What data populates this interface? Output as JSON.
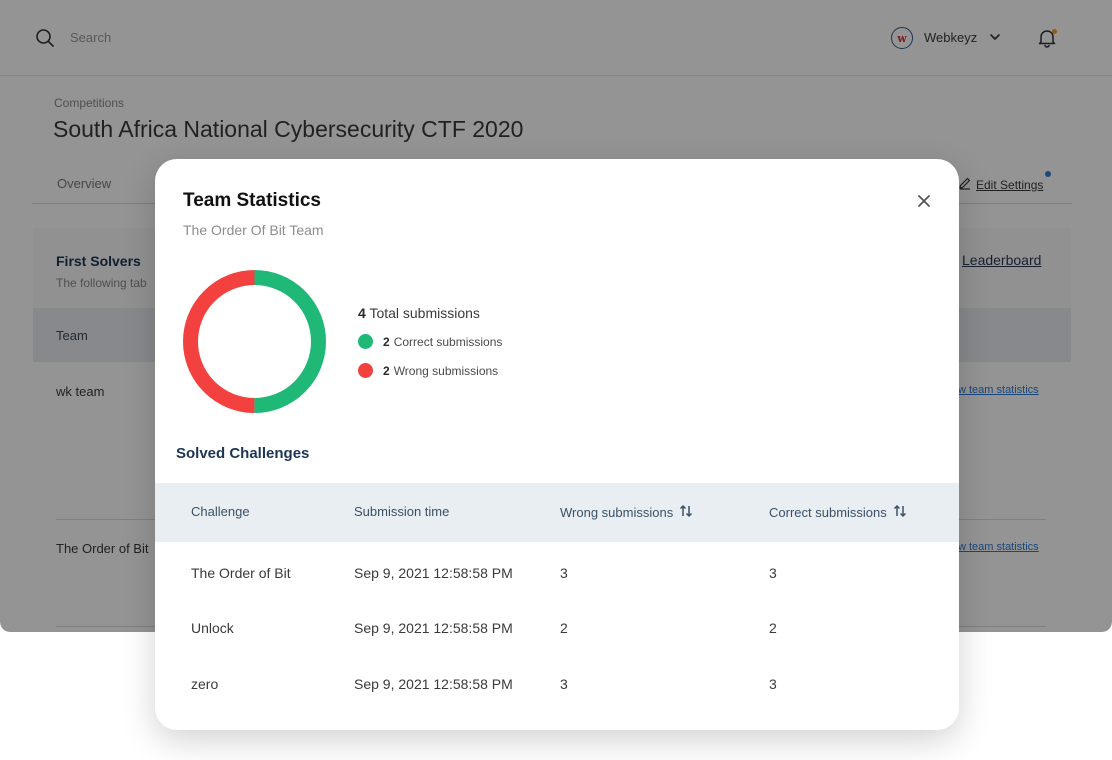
{
  "header": {
    "search_placeholder": "Search",
    "org_name": "Webkeyz",
    "org_logo_text": "w"
  },
  "page": {
    "breadcrumb": "Competitions",
    "title": "South Africa National Cybersecurity CTF 2020",
    "tab_overview": "Overview",
    "edit_settings": "Edit Settings"
  },
  "first_solvers": {
    "title": "First Solvers",
    "subtitle": "The following tab",
    "leaderboard_link": "Leaderboard",
    "column_team": "Team",
    "rows": [
      {
        "team": "wk team",
        "link": "w team statistics"
      },
      {
        "team": "The Order of Bit",
        "link": "w team statistics"
      }
    ]
  },
  "modal": {
    "title": "Team Statistics",
    "subtitle": "The Order Of Bit Team",
    "total_count": "4",
    "total_label": "Total submissions",
    "correct_count": "2",
    "correct_label": "Correct submissions",
    "wrong_count": "2",
    "wrong_label": "Wrong submissions",
    "solved_title": "Solved Challenges",
    "columns": [
      "Challenge",
      "Submission time",
      "Wrong submissions",
      "Correct submissions"
    ],
    "rows": [
      {
        "challenge": "The Order of Bit",
        "time": "Sep 9, 2021 12:58:58 PM",
        "wrong": "3",
        "correct": "3"
      },
      {
        "challenge": "Unlock",
        "time": "Sep 9, 2021 12:58:58 PM",
        "wrong": "2",
        "correct": "2"
      },
      {
        "challenge": "zero",
        "time": "Sep 9, 2021 12:58:58 PM",
        "wrong": "3",
        "correct": "3"
      }
    ]
  },
  "chart_data": {
    "type": "pie",
    "categories": [
      "Correct submissions",
      "Wrong submissions"
    ],
    "values": [
      2,
      2
    ],
    "colors": [
      "#1fb877",
      "#f2413f"
    ]
  },
  "colors": {
    "correct": "#1fb877",
    "wrong": "#f2413f",
    "heading": "#1d3557",
    "table_header_bg": "#e9eef2"
  },
  "icons": {
    "search": "search-icon",
    "chevron": "chevron-down-icon",
    "bell": "bell-icon",
    "close": "close-icon",
    "sort": "sort-icon",
    "edit": "pencil-icon"
  }
}
